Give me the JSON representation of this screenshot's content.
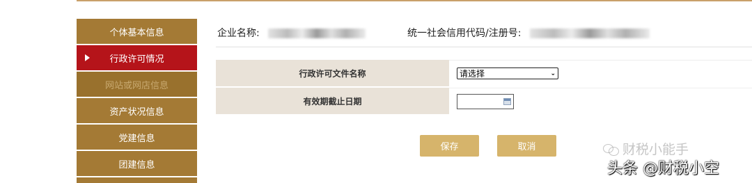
{
  "sidebar": {
    "items": [
      {
        "label": "个体基本信息",
        "state": "normal"
      },
      {
        "label": "行政许可情况",
        "state": "active"
      },
      {
        "label": "网站或网店信息",
        "state": "disabled"
      },
      {
        "label": "资产状况信息",
        "state": "normal"
      },
      {
        "label": "党建信息",
        "state": "normal"
      },
      {
        "label": "团建信息",
        "state": "normal"
      }
    ]
  },
  "header": {
    "company_label": "企业名称:",
    "credit_code_label": "统一社会信用代码/注册号:"
  },
  "form": {
    "license_name_label": "行政许可文件名称",
    "license_select_value": "请选择",
    "expiry_date_label": "有效期截止日期",
    "expiry_date_value": ""
  },
  "actions": {
    "save_label": "保存",
    "cancel_label": "取消"
  },
  "watermark": {
    "line1": "财税小能手",
    "line2": "头条 @财税小空"
  },
  "colors": {
    "sidebar_bg": "#a47a35",
    "sidebar_active": "#b5141a",
    "button_bg": "#d6b46b",
    "label_bg": "#e9e2d8"
  }
}
